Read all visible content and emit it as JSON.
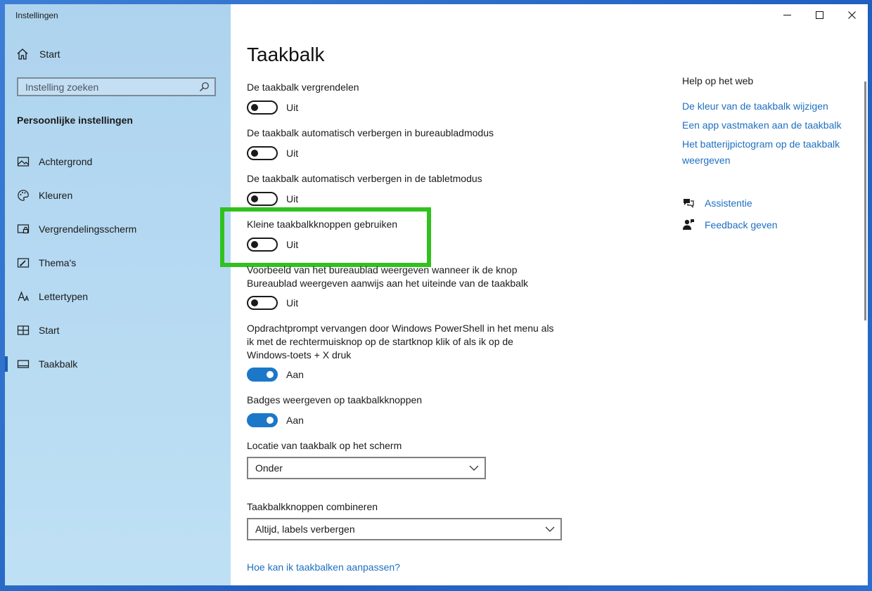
{
  "app": {
    "title": "Instellingen"
  },
  "sidebar": {
    "home_label": "Start",
    "search": {
      "placeholder": "Instelling zoeken"
    },
    "section_title": "Persoonlijke instellingen",
    "items": [
      {
        "label": "Achtergrond",
        "icon": "image-icon"
      },
      {
        "label": "Kleuren",
        "icon": "palette-icon"
      },
      {
        "label": "Vergrendelingsscherm",
        "icon": "lock-screen-icon"
      },
      {
        "label": "Thema's",
        "icon": "brush-icon"
      },
      {
        "label": "Lettertypen",
        "icon": "font-icon"
      },
      {
        "label": "Start",
        "icon": "start-tiles-icon"
      },
      {
        "label": "Taakbalk",
        "icon": "taskbar-icon",
        "active": true
      }
    ]
  },
  "main": {
    "title": "Taakbalk",
    "settings": [
      {
        "label": "De taakbalk vergrendelen",
        "state": "Uit",
        "on": false
      },
      {
        "label": "De taakbalk automatisch verbergen in bureaubladmodus",
        "state": "Uit",
        "on": false
      },
      {
        "label": "De taakbalk automatisch verbergen in de tabletmodus",
        "state": "Uit",
        "on": false
      },
      {
        "label": "Kleine taakbalkknoppen gebruiken",
        "state": "Uit",
        "on": false
      },
      {
        "label_lines": [
          "Voorbeeld van het bureaublad weergeven wanneer ik de knop",
          "Bureaublad weergeven aanwijs aan het uiteinde van de taakbalk"
        ],
        "state": "Uit",
        "on": false
      },
      {
        "label_lines": [
          "Opdrachtprompt vervangen door Windows PowerShell in het menu als",
          "ik met de rechtermuisknop op de startknop klik of als ik op de",
          "Windows-toets + X druk"
        ],
        "state": "Aan",
        "on": true
      },
      {
        "label": "Badges weergeven op taakbalkknoppen",
        "state": "Aan",
        "on": true
      }
    ],
    "location": {
      "label": "Locatie van taakbalk op het scherm",
      "value": "Onder"
    },
    "combine": {
      "label": "Taakbalkknoppen combineren",
      "value": "Altijd, labels verbergen"
    },
    "bottom_link": "Hoe kan ik taakbalken aanpassen?"
  },
  "help": {
    "title": "Help op het web",
    "links": [
      "De kleur van de taakbalk wijzigen",
      "Een app vastmaken aan de taakbalk",
      [
        "Het batterijpictogram op de taakbalk",
        "weergeven"
      ]
    ],
    "assist_label": "Assistentie",
    "feedback_label": "Feedback geven"
  },
  "colors": {
    "accent": "#1b78c8",
    "highlight": "#31c11e",
    "link": "#1e6fc0"
  }
}
